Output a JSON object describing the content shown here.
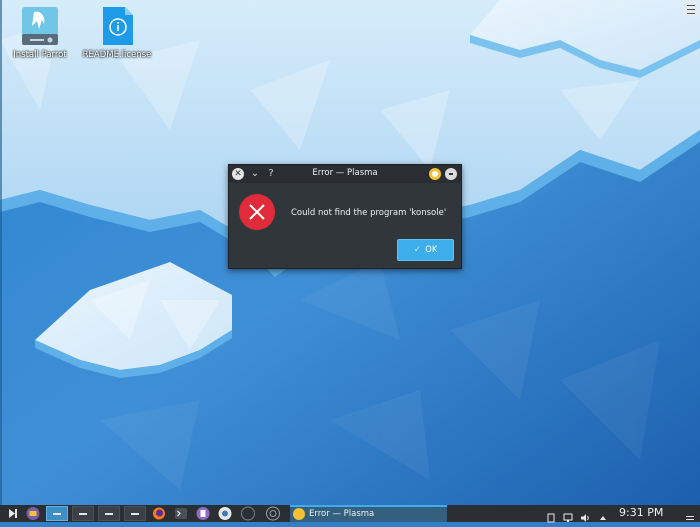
{
  "desktop": {
    "icons": [
      {
        "label": "Install Parrot"
      },
      {
        "label": "README.license"
      }
    ]
  },
  "dialog": {
    "title": "Error — Plasma",
    "message": "Could not find the program 'konsole'",
    "ok_label": "OK",
    "help_glyph": "?",
    "menu_glyph": "⌄",
    "close_glyph": "✕"
  },
  "taskbar": {
    "task_label": "Error — Plasma",
    "clock": "9:31 PM",
    "pager_count": 4,
    "active_pager": 1
  },
  "colors": {
    "accent": "#3daee9",
    "error_red": "#e02c3a",
    "dialog_bg": "#31363b",
    "panel_bg": "#2b2f33"
  }
}
